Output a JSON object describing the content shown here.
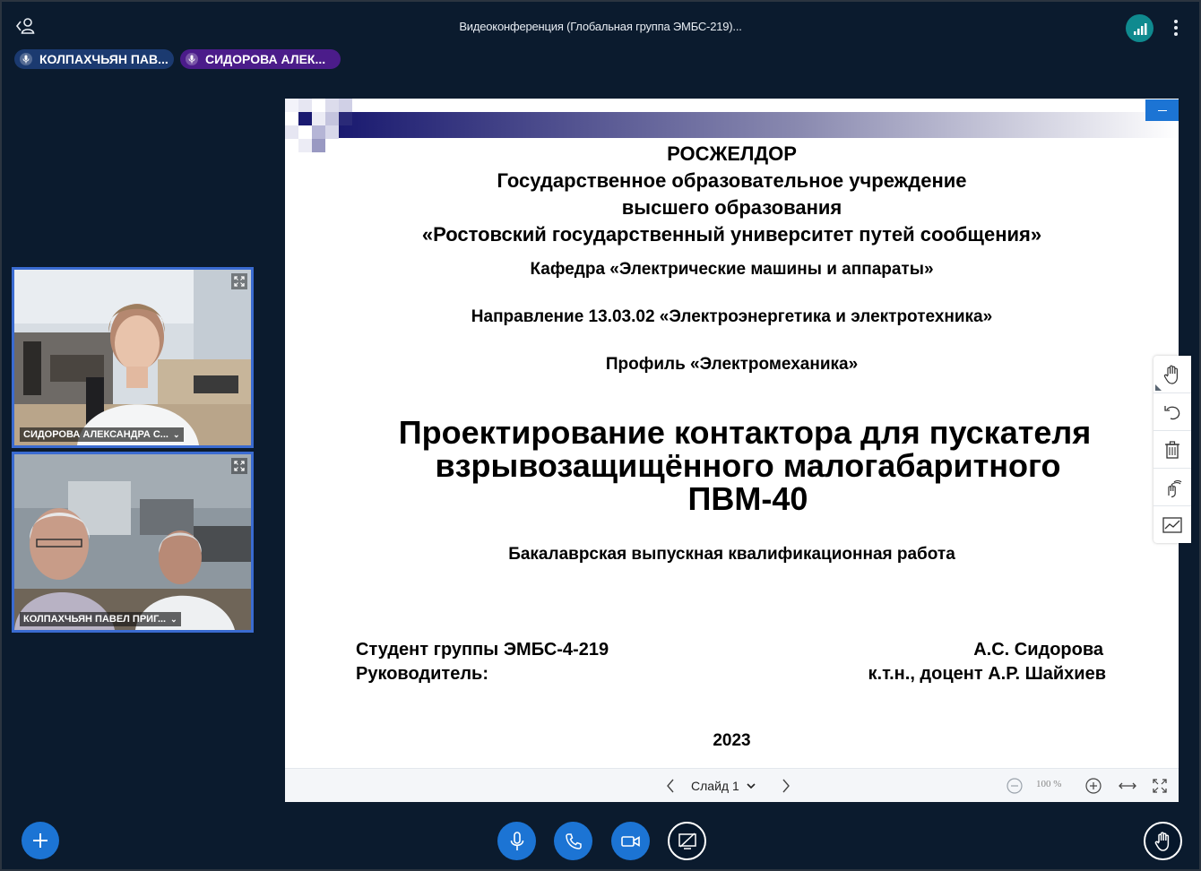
{
  "app": {
    "meeting_title": "Видеоконференция (Глобальная группа ЭМБС-219)...",
    "accent_color": "#1c74d4",
    "background_color": "#06172b"
  },
  "talkers": [
    {
      "label": "КОЛПАХЧЬЯН ПАВ...",
      "color": "#1b3a70",
      "icon": "mic-icon"
    },
    {
      "label": "СИДОРОВА АЛЕК...",
      "color": "#4b1c8a",
      "icon": "mic-icon"
    }
  ],
  "videos": [
    {
      "name": "СИДОРОВА АЛЕКСАНДРА С..."
    },
    {
      "name": "КОЛПАХЧЬЯН ПАВЕЛ ПРИГ..."
    }
  ],
  "slide": {
    "org_line1": "РОСЖЕЛДОР",
    "org_line2": "Государственное образовательное учреждение",
    "org_line3": "высшего образования",
    "org_line4": "«Ростовский государственный университет путей сообщения»",
    "department": "Кафедра «Электрические машины и аппараты»",
    "direction": "Направление 13.03.02  «Электроэнергетика и электротехника»",
    "profile": "Профиль «Электромеханика»",
    "title_line1": "Проектирование контактора для пускателя",
    "title_line2": "взрывозащищённого малогабаритного",
    "title_line3": "ПВМ-40",
    "subtitle": "Бакалаврская выпускная квалификационная работа",
    "student_label": "Студент группы ЭМБС-4-219",
    "student_name": "А.С. Сидорова",
    "supervisor_label": "Руководитель:",
    "supervisor_name": "к.т.н., доцент А.Р. Шайхиев",
    "year": "2023"
  },
  "presentation_toolbar": {
    "slide_selector": "Слайд 1",
    "zoom": "100 %"
  },
  "whiteboard_tools": [
    "hand-icon",
    "undo-icon",
    "trash-icon",
    "multi-user-icon",
    "chart-icon"
  ],
  "controls": [
    "plus-icon",
    "mic-icon",
    "phone-icon",
    "camera-icon",
    "screen-share-off-icon",
    "raise-hand-icon"
  ]
}
